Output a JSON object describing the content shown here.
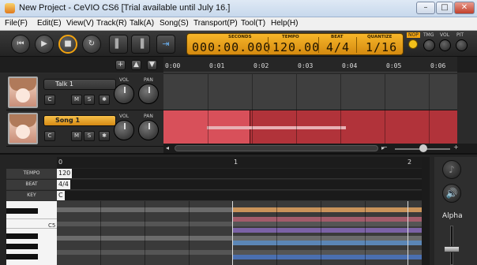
{
  "window": {
    "title": "New Project - CeVIO CS6 [Trial available until July 16.]",
    "minimize": "–",
    "maximize": "□",
    "close": "✕"
  },
  "menu": [
    "File(F)",
    "Edit(E)",
    "View(V)",
    "Track(R)",
    "Talk(A)",
    "Song(S)",
    "Transport(P)",
    "Tool(T)",
    "Help(H)"
  ],
  "transport": {
    "rewind_icon": "⏮",
    "play_icon": "▶",
    "stop_icon": "■",
    "loop_icon": "↻",
    "left_icon": "▌",
    "right_icon": "▐",
    "export_icon": "⇥"
  },
  "lcd": {
    "seconds_label": "SECONDS",
    "seconds": "000:00.000",
    "tempo_label": "TEMPO",
    "tempo": "120.00",
    "beat_label": "BEAT",
    "beat": "4/4",
    "quantize_label": "QUANTIZE",
    "quantize": "1/16"
  },
  "mini": {
    "nop": "NOP",
    "tmg": "TMG",
    "vol": "VOL",
    "pit": "PIT"
  },
  "track_header_buttons": [
    "+",
    "▲",
    "▼"
  ],
  "ruler": [
    "0:00",
    "0:01",
    "0:02",
    "0:03",
    "0:04",
    "0:05",
    "0:06"
  ],
  "tracks": [
    {
      "name": "Talk 1",
      "mode_c": "C",
      "mute": "M",
      "solo": "S",
      "fx": "✱",
      "vol_label": "VOL",
      "pan_label": "PAN"
    },
    {
      "name": "Song 1",
      "mode_c": "C",
      "mute": "M",
      "solo": "S",
      "fx": "✱",
      "vol_label": "VOL",
      "pan_label": "PAN"
    }
  ],
  "scroll": {
    "minus": "−",
    "plus": "+",
    "left": "◂",
    "right": "▸"
  },
  "editor": {
    "ruler": [
      "0",
      "1",
      "2"
    ],
    "params": [
      {
        "label": "TEMPO",
        "value": "120"
      },
      {
        "label": "BEAT",
        "value": "4/4"
      },
      {
        "label": "KEY",
        "value": "C"
      }
    ],
    "piano_label": "C5",
    "alpha_label": "Alpha",
    "right_icon_1": "♪",
    "right_icon_2": "🔊"
  },
  "colors": {
    "accent": "#f2a30f",
    "song_lane": "#b1333a",
    "note_block": "#d8505a",
    "talk_lane": "#3f3f3f"
  }
}
